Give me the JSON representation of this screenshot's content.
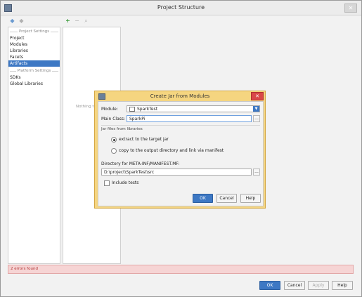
{
  "window": {
    "title": "Project Structure",
    "close_glyph": "✕"
  },
  "toolbar": {
    "back_glyph": "◆",
    "forward_glyph": "◆",
    "add_glyph": "+",
    "remove_glyph": "−",
    "search_glyph": "⌕"
  },
  "sidebar": {
    "project_settings_header": "Project Settings",
    "items": [
      {
        "label": "Project"
      },
      {
        "label": "Modules"
      },
      {
        "label": "Libraries"
      },
      {
        "label": "Facets"
      },
      {
        "label": "Artifacts"
      }
    ],
    "selected_index": 4,
    "platform_settings_header": "Platform Settings",
    "platform_items": [
      {
        "label": "SDKs"
      },
      {
        "label": "Global Libraries"
      }
    ]
  },
  "middle": {
    "nothing_text": "Nothing to"
  },
  "status": {
    "errors_text": "2 errors found"
  },
  "footer": {
    "ok": "OK",
    "cancel": "Cancel",
    "apply": "Apply",
    "help": "Help"
  },
  "dialog": {
    "title": "Create Jar from Modules",
    "close_glyph": "✕",
    "module_label": "Module:",
    "module_value": "SparkTest",
    "main_class_label": "Main Class:",
    "main_class_value": "SparkPi",
    "jar_files_label": "Jar files from libraries",
    "option_extract": "extract to the target jar",
    "option_copy": "copy to the output directory and link via manifest",
    "selected_option": "extract",
    "manifest_label": "Directory for META-INF/MANIFEST.MF:",
    "manifest_value": "D:\\project\\SparkTest\\src",
    "include_tests_label": "Include tests",
    "include_tests_checked": false,
    "dots_glyph": "...",
    "arrow_glyph": "▼",
    "ok": "OK",
    "cancel": "Cancel",
    "help": "Help"
  },
  "colors": {
    "accent": "#3d78c4",
    "dialog_frame": "#f5d580",
    "error_bg": "#f6d4d4"
  }
}
